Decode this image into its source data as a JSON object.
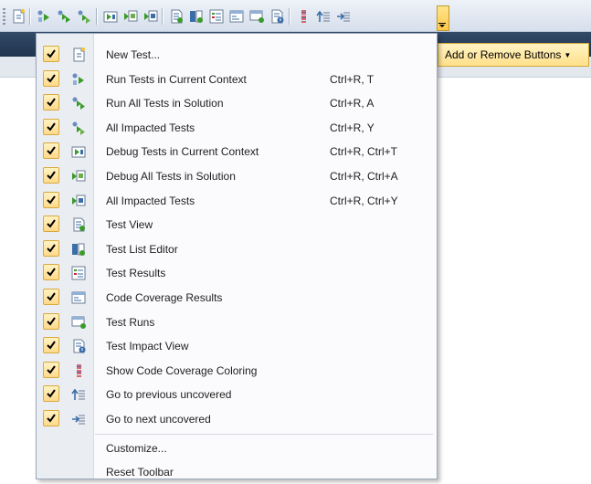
{
  "toolbar": {
    "buttons": [
      "new-test-icon",
      "run-tests-in-context-icon",
      "run-all-tests-icon",
      "run-impacted-tests-icon",
      "debug-tests-in-context-icon",
      "debug-all-tests-icon",
      "debug-impacted-tests-icon",
      "test-view-icon",
      "test-list-editor-icon",
      "test-results-icon",
      "code-coverage-results-icon",
      "test-runs-icon",
      "test-impact-view-icon",
      "show-coverage-coloring-icon",
      "previous-uncovered-icon",
      "next-uncovered-icon"
    ]
  },
  "add_remove_buttons": "Add or Remove Buttons",
  "menu": {
    "items": [
      {
        "label": "New Test...",
        "shortcut": "",
        "checked": true,
        "icon": "new-test-icon"
      },
      {
        "label": "Run Tests in Current Context",
        "shortcut": "Ctrl+R, T",
        "checked": true,
        "icon": "run-tests-in-context-icon"
      },
      {
        "label": "Run All Tests in Solution",
        "shortcut": "Ctrl+R, A",
        "checked": true,
        "icon": "run-all-tests-icon"
      },
      {
        "label": "All Impacted Tests",
        "shortcut": "Ctrl+R, Y",
        "checked": true,
        "icon": "run-impacted-tests-icon"
      },
      {
        "label": "Debug Tests in Current Context",
        "shortcut": "Ctrl+R, Ctrl+T",
        "checked": true,
        "icon": "debug-tests-in-context-icon"
      },
      {
        "label": "Debug All Tests in Solution",
        "shortcut": "Ctrl+R, Ctrl+A",
        "checked": true,
        "icon": "debug-all-tests-icon"
      },
      {
        "label": "All Impacted Tests",
        "shortcut": "Ctrl+R, Ctrl+Y",
        "checked": true,
        "icon": "debug-impacted-tests-icon"
      },
      {
        "label": "Test View",
        "shortcut": "",
        "checked": true,
        "icon": "test-view-icon"
      },
      {
        "label": "Test List Editor",
        "shortcut": "",
        "checked": true,
        "icon": "test-list-editor-icon"
      },
      {
        "label": "Test Results",
        "shortcut": "",
        "checked": true,
        "icon": "test-results-icon"
      },
      {
        "label": "Code Coverage Results",
        "shortcut": "",
        "checked": true,
        "icon": "code-coverage-results-icon"
      },
      {
        "label": "Test Runs",
        "shortcut": "",
        "checked": true,
        "icon": "test-runs-icon"
      },
      {
        "label": "Test Impact View",
        "shortcut": "",
        "checked": true,
        "icon": "test-impact-view-icon"
      },
      {
        "label": "Show Code Coverage Coloring",
        "shortcut": "",
        "checked": true,
        "icon": "show-coverage-coloring-icon"
      },
      {
        "label": "Go to previous uncovered",
        "shortcut": "",
        "checked": true,
        "icon": "previous-uncovered-icon"
      },
      {
        "label": "Go to next uncovered",
        "shortcut": "",
        "checked": true,
        "icon": "next-uncovered-icon"
      }
    ],
    "customize": "Customize...",
    "reset_toolbar": "Reset Toolbar"
  },
  "colors": {
    "check_bg": "#ffe08a",
    "check_border": "#d9a93e",
    "highlight_bg": "#ffe08a",
    "title_bar": "#2b405b",
    "run_green": "#3a9a2a",
    "doc_blue": "#3a6ea8"
  }
}
